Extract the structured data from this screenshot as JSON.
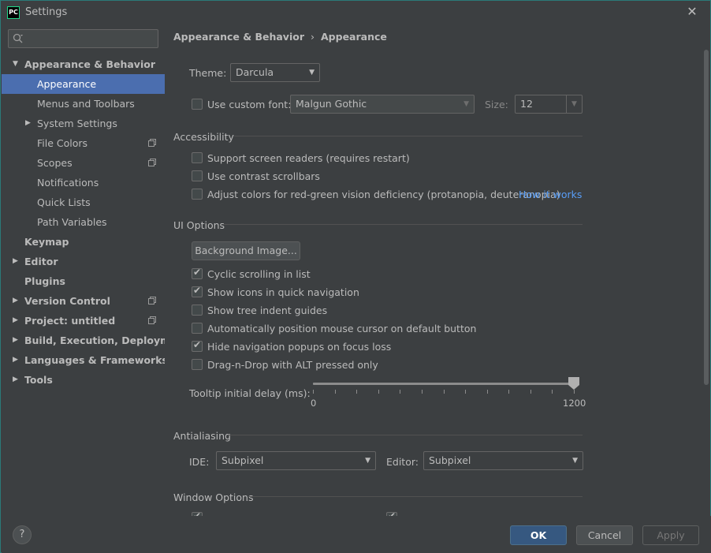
{
  "window": {
    "title": "Settings",
    "app_icon_text": "PC",
    "close_glyph": "✕"
  },
  "sidebar": {
    "search": {
      "value": "",
      "placeholder": ""
    },
    "items": [
      {
        "label": "Appearance & Behavior",
        "bold": true,
        "expanded": true,
        "level": 0
      },
      {
        "label": "Appearance",
        "level": 1,
        "selected": true
      },
      {
        "label": "Menus and Toolbars",
        "level": 1
      },
      {
        "label": "System Settings",
        "level": 1,
        "collapsed": true
      },
      {
        "label": "File Colors",
        "level": 1,
        "copy_icon": true
      },
      {
        "label": "Scopes",
        "level": 1,
        "copy_icon": true
      },
      {
        "label": "Notifications",
        "level": 1
      },
      {
        "label": "Quick Lists",
        "level": 1
      },
      {
        "label": "Path Variables",
        "level": 1
      },
      {
        "label": "Keymap",
        "bold": true,
        "level": 0
      },
      {
        "label": "Editor",
        "bold": true,
        "level": 0,
        "collapsed": true
      },
      {
        "label": "Plugins",
        "bold": true,
        "level": 0
      },
      {
        "label": "Version Control",
        "bold": true,
        "level": 0,
        "collapsed": true,
        "copy_icon": true
      },
      {
        "label": "Project: untitled",
        "bold": true,
        "level": 0,
        "collapsed": true,
        "copy_icon": true
      },
      {
        "label": "Build, Execution, Deployment",
        "bold": true,
        "level": 0,
        "collapsed": true
      },
      {
        "label": "Languages & Frameworks",
        "bold": true,
        "level": 0,
        "collapsed": true
      },
      {
        "label": "Tools",
        "bold": true,
        "level": 0,
        "collapsed": true
      }
    ]
  },
  "breadcrumb": {
    "parent": "Appearance & Behavior",
    "separator": "›",
    "current": "Appearance"
  },
  "theme": {
    "label": "Theme:",
    "value": "Darcula"
  },
  "custom_font": {
    "label": "Use custom font:",
    "checked": false,
    "font_value": "Malgun Gothic",
    "size_label": "Size:",
    "size_value": "12"
  },
  "accessibility": {
    "title": "Accessibility",
    "options": [
      {
        "label": "Support screen readers (requires restart)",
        "checked": false
      },
      {
        "label": "Use contrast scrollbars",
        "checked": false
      },
      {
        "label": "Adjust colors for red-green vision deficiency (protanopia, deuteranopia)",
        "checked": false
      }
    ],
    "link": "How it works"
  },
  "ui_options": {
    "title": "UI Options",
    "background_button": "Background Image...",
    "options": [
      {
        "label": "Cyclic scrolling in list",
        "checked": true
      },
      {
        "label": "Show icons in quick navigation",
        "checked": true
      },
      {
        "label": "Show tree indent guides",
        "checked": false
      },
      {
        "label": "Automatically position mouse cursor on default button",
        "checked": false
      },
      {
        "label": "Hide navigation popups on focus loss",
        "checked": true
      },
      {
        "label": "Drag-n-Drop with ALT pressed only",
        "checked": false
      }
    ],
    "tooltip_delay": {
      "label": "Tooltip initial delay (ms):",
      "min": "0",
      "max": "1200",
      "value": 1200
    }
  },
  "antialiasing": {
    "title": "Antialiasing",
    "ide_label": "IDE:",
    "ide_value": "Subpixel",
    "editor_label": "Editor:",
    "editor_value": "Subpixel"
  },
  "window_options": {
    "title": "Window Options"
  },
  "footer": {
    "help": "?",
    "ok": "OK",
    "cancel": "Cancel",
    "apply": "Apply"
  },
  "colors": {
    "selection": "#4b6eaf",
    "link": "#589df6",
    "ok_button": "#365880"
  }
}
